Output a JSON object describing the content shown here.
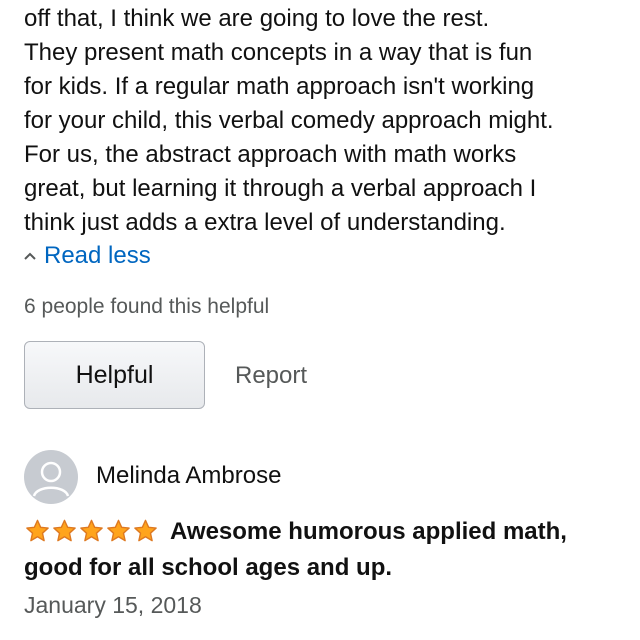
{
  "review": {
    "body_lines": [
      "off that, I think we are going to love the rest.",
      "They present math concepts in a way that is fun",
      "for kids. If a regular math approach isn't working",
      "for your child, this verbal comedy approach might.",
      "For us, the abstract approach with math works",
      "great, but learning it through a verbal approach I",
      "think just adds a extra level of understanding."
    ],
    "read_less_label": "Read less",
    "helpful_count_text": "6 people found this helpful",
    "helpful_button_label": "Helpful",
    "report_label": "Report"
  },
  "next_review": {
    "reviewer_name": "Melinda Ambrose",
    "rating": 5,
    "max_rating": 5,
    "title": "Awesome humorous applied math, good for all school ages and up.",
    "date": "January 15, 2018"
  },
  "colors": {
    "link": "#0066c0",
    "star_fill": "#ffa41c",
    "star_stroke": "#de7921",
    "muted_text": "#565959",
    "avatar_bg": "#c7cbd1"
  },
  "icons": {
    "chevron": "chevron-up-icon",
    "avatar": "person-avatar-icon",
    "star": "star-icon"
  }
}
